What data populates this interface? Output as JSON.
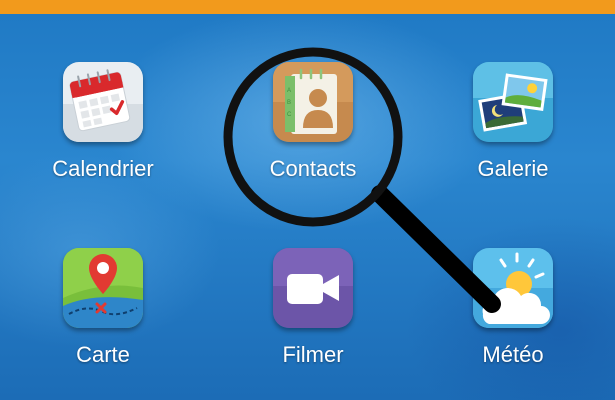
{
  "apps": [
    {
      "label": "Calendrier",
      "icon": "calendar-icon"
    },
    {
      "label": "Contacts",
      "icon": "contacts-icon"
    },
    {
      "label": "Galerie",
      "icon": "gallery-icon"
    },
    {
      "label": "Carte",
      "icon": "map-icon"
    },
    {
      "label": "Filmer",
      "icon": "video-camera-icon"
    },
    {
      "label": "Météo",
      "icon": "weather-icon"
    }
  ],
  "overlay": {
    "icon": "magnifying-glass-icon"
  },
  "colors": {
    "top_bar": "#f29a1c",
    "background": "#1f79c4",
    "label_text": "#ffffff"
  }
}
